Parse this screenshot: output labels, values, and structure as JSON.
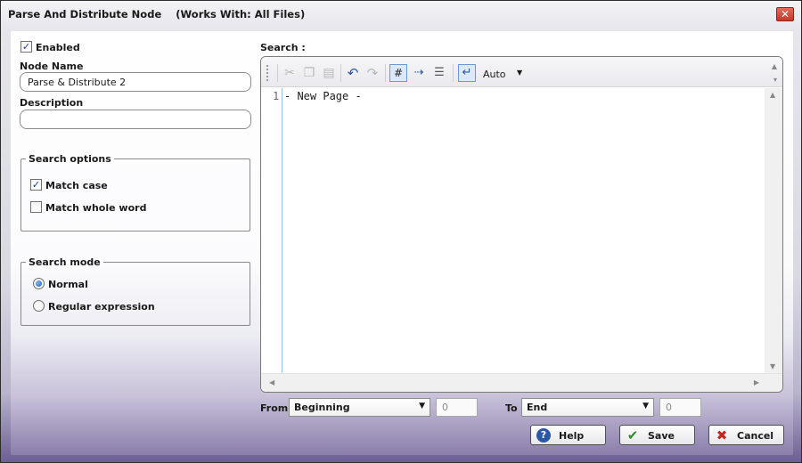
{
  "window": {
    "title": "Parse And Distribute Node    (Works With: All Files)",
    "close_glyph": "✕"
  },
  "left": {
    "enabled_label": "Enabled",
    "enabled_checked": true,
    "node_name_label": "Node Name",
    "node_name_value": "Parse & Distribute 2",
    "description_label": "Description",
    "description_value": "",
    "search_options": {
      "legend": "Search options",
      "match_case_label": "Match case",
      "match_case_checked": true,
      "match_whole_word_label": "Match whole word",
      "match_whole_word_checked": false
    },
    "search_mode": {
      "legend": "Search mode",
      "normal_label": "Normal",
      "regex_label": "Regular expression",
      "selected": "Normal"
    }
  },
  "editor": {
    "label": "Search :",
    "toolbar": {
      "icons": [
        "cut-icon",
        "copy-icon",
        "paste-icon",
        "undo-icon",
        "redo-icon",
        "line-numbers-icon",
        "show-whitespace-icon",
        "word-wrap-icon",
        "enter-icon"
      ],
      "encoding_value": "Auto"
    },
    "line_number": "1",
    "content": "- New Page -"
  },
  "range": {
    "from_label": "From",
    "from_value": "Beginning",
    "from_offset": "0",
    "to_label": "To",
    "to_value": "End",
    "to_offset": "0"
  },
  "buttons": {
    "help": "Help",
    "save": "Save",
    "cancel": "Cancel"
  },
  "colors": {
    "accent": "#2b57a8",
    "cancel_x": "#c2281f",
    "save_check": "#2e8b2e"
  }
}
